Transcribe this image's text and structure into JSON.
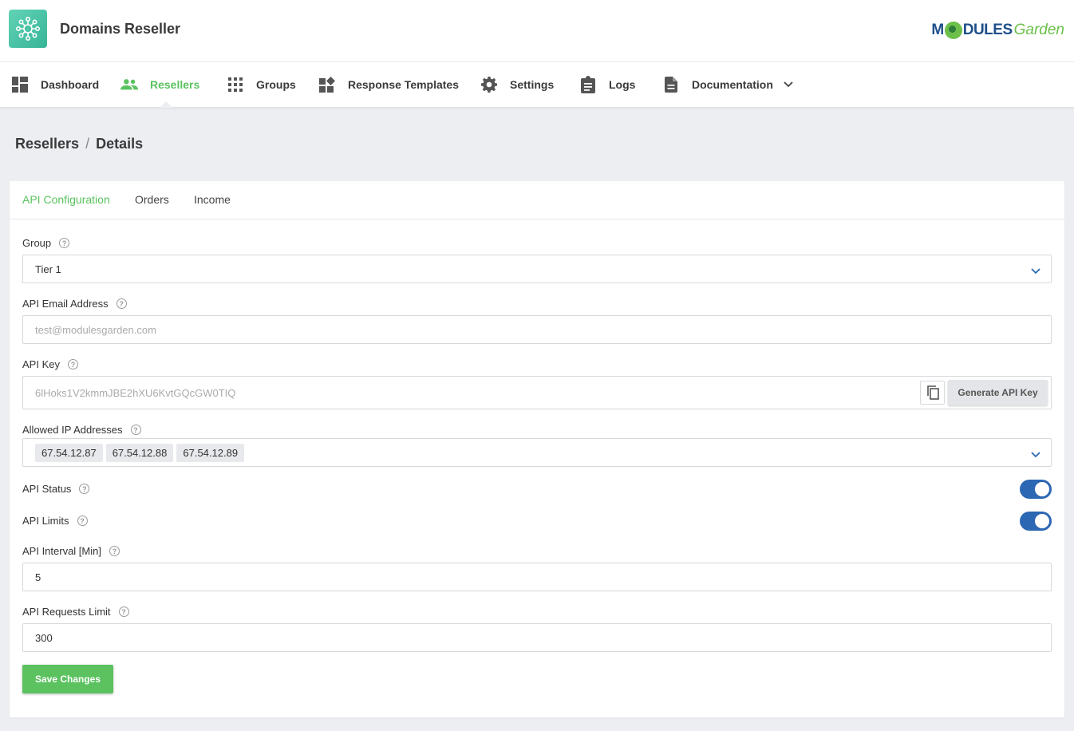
{
  "app": {
    "title": "Domains Reseller",
    "brand_part1": "M",
    "brand_part2": "DULES",
    "brand_part3": "Garden"
  },
  "nav": {
    "items": [
      {
        "label": "Dashboard",
        "icon": "dashboard-icon"
      },
      {
        "label": "Resellers",
        "icon": "people-icon",
        "active": true
      },
      {
        "label": "Groups",
        "icon": "grid-icon"
      },
      {
        "label": "Response Templates",
        "icon": "widgets-icon"
      },
      {
        "label": "Settings",
        "icon": "gear-icon"
      },
      {
        "label": "Logs",
        "icon": "clipboard-icon"
      },
      {
        "label": "Documentation",
        "icon": "document-icon"
      }
    ]
  },
  "breadcrumb": {
    "parent": "Resellers",
    "separator": "/",
    "current": "Details"
  },
  "tabs": [
    "API Configuration",
    "Orders",
    "Income"
  ],
  "form": {
    "group": {
      "label": "Group",
      "value": "Tier 1"
    },
    "email": {
      "label": "API Email Address",
      "placeholder": "test@modulesgarden.com"
    },
    "api_key": {
      "label": "API Key",
      "value": "6lHoks1V2kmmJBE2hXU6KvtGQcGW0TIQ",
      "generate_label": "Generate API Key"
    },
    "allowed_ips": {
      "label": "Allowed IP Addresses",
      "values": [
        "67.54.12.87",
        "67.54.12.88",
        "67.54.12.89"
      ]
    },
    "api_status": {
      "label": "API Status",
      "enabled": true
    },
    "api_limits": {
      "label": "API Limits",
      "enabled": true
    },
    "api_interval": {
      "label": "API Interval [Min]",
      "value": "5"
    },
    "api_requests_limit": {
      "label": "API Requests Limit",
      "value": "300"
    },
    "help_glyph": "?",
    "save_label": "Save Changes"
  },
  "colors": {
    "accent": "#5bc25f",
    "toggle_on": "#2c67b3",
    "brand_blue": "#1f4f8b"
  }
}
